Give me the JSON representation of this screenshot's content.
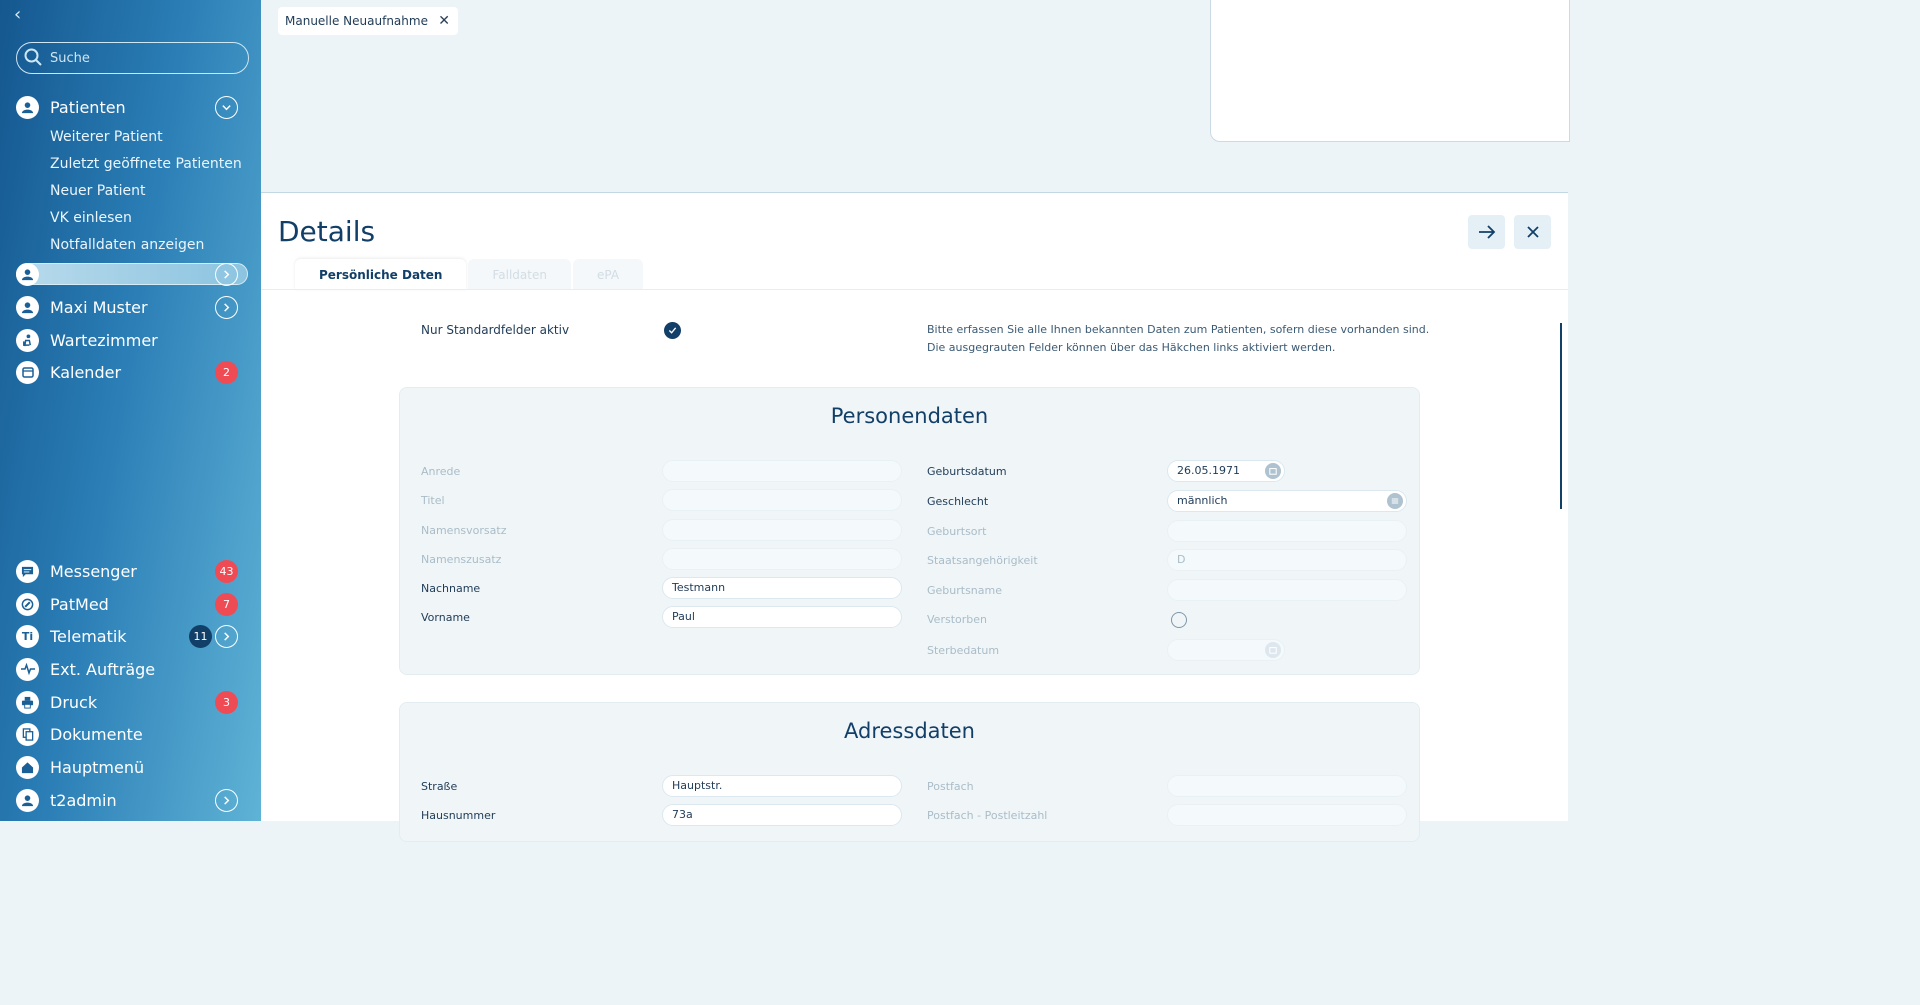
{
  "sidebar": {
    "search_placeholder": "Suche",
    "patients": {
      "label": "Patienten",
      "subitems": [
        "Weiterer Patient",
        "Zuletzt geöffnete Patienten",
        "Neuer Patient",
        "VK einlesen",
        "Notfalldaten anzeigen"
      ]
    },
    "items_top": [
      {
        "label": "Maxi Muster"
      },
      {
        "label": "Wartezimmer"
      },
      {
        "label": "Kalender",
        "badge": "2"
      }
    ],
    "items_bottom": [
      {
        "label": "Messenger",
        "badge": "43"
      },
      {
        "label": "PatMed",
        "badge": "7"
      },
      {
        "label": "Telematik",
        "badge": "11"
      },
      {
        "label": "Ext. Aufträge"
      },
      {
        "label": "Druck",
        "badge": "3"
      },
      {
        "label": "Dokumente"
      },
      {
        "label": "Hauptmenü"
      },
      {
        "label": "t2admin"
      }
    ]
  },
  "top": {
    "tab_chip": "Manuelle Neuaufnahme"
  },
  "details": {
    "title": "Details",
    "tabs": [
      "Persönliche Daten",
      "Falldaten",
      "ePA"
    ],
    "std_fields_label": "Nur Standardfelder aktiv",
    "hint_line1": "Bitte erfassen Sie alle Ihnen bekannten Daten zum Patienten, sofern diese vorhanden sind.",
    "hint_line2": "Die ausgegrauten Felder können über das Häkchen links aktiviert werden.",
    "personendaten": {
      "title": "Personendaten",
      "left": [
        {
          "label": "Anrede",
          "value": "",
          "active": false
        },
        {
          "label": "Titel",
          "value": "",
          "active": false
        },
        {
          "label": "Namensvorsatz",
          "value": "",
          "active": false
        },
        {
          "label": "Namenszusatz",
          "value": "",
          "active": false
        },
        {
          "label": "Nachname",
          "value": "Testmann",
          "active": true
        },
        {
          "label": "Vorname",
          "value": "Paul",
          "active": true
        }
      ],
      "right": [
        {
          "label": "Geburtsdatum",
          "value": "26.05.1971",
          "active": true
        },
        {
          "label": "Geschlecht",
          "value": "männlich",
          "active": true
        },
        {
          "label": "Geburtsort",
          "value": "",
          "active": false
        },
        {
          "label": "Staatsangehörigkeit",
          "value": "D",
          "active": false
        },
        {
          "label": "Geburtsname",
          "value": "",
          "active": false
        },
        {
          "label": "Verstorben",
          "value": "",
          "active": false
        },
        {
          "label": "Sterbedatum",
          "value": "",
          "active": false
        }
      ]
    },
    "adressdaten": {
      "title": "Adressdaten",
      "left": [
        {
          "label": "Straße",
          "value": "Hauptstr.",
          "active": true
        },
        {
          "label": "Hausnummer",
          "value": "73a",
          "active": true
        }
      ],
      "right": [
        {
          "label": "Postfach",
          "value": "",
          "active": false
        },
        {
          "label": "Postfach - Postleitzahl",
          "value": "",
          "active": false
        }
      ]
    }
  }
}
